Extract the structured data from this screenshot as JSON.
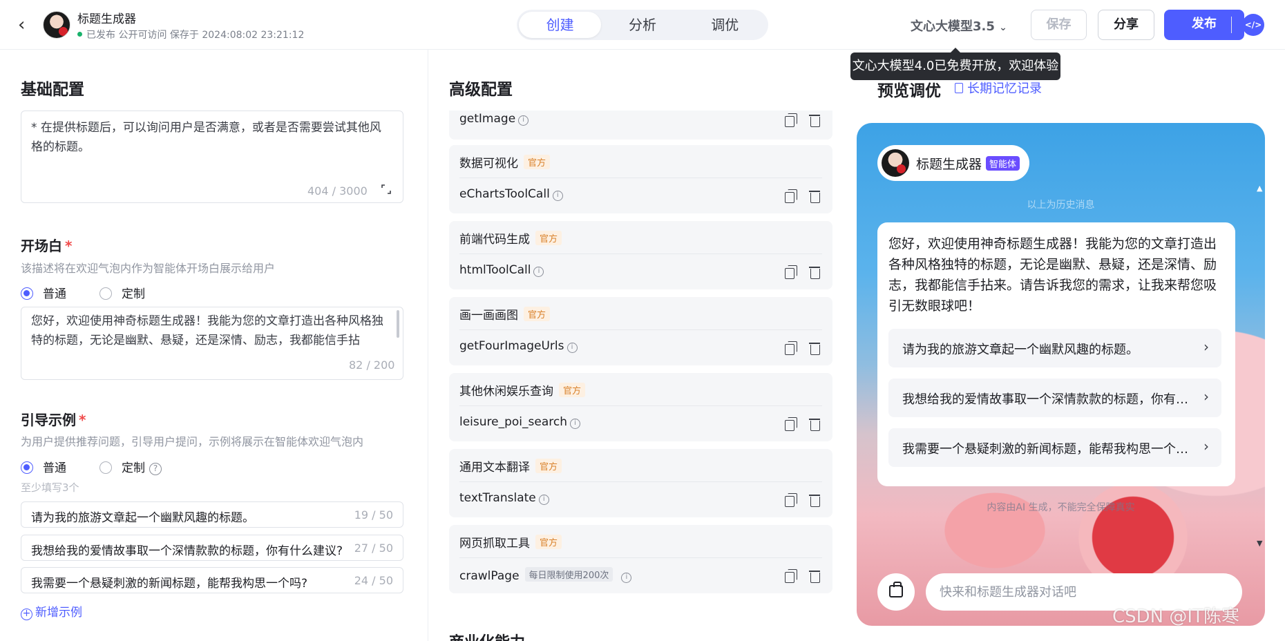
{
  "header": {
    "app_name": "标题生成器",
    "status": "已发布 公开可访问 保存于 2024:08:02 23:21:12",
    "tabs": [
      {
        "label": "创建",
        "active": true
      },
      {
        "label": "分析",
        "active": false
      },
      {
        "label": "调优",
        "active": false
      }
    ],
    "model": "文心大模型3.5",
    "save": "保存",
    "share": "分享",
    "publish": "发布"
  },
  "tooltip": "文心大模型4.0已免费开放，欢迎体验",
  "basic": {
    "title": "基础配置",
    "prompt_excerpt": "* 在提供标题后，可以询问用户是否满意，或者是否需要尝试其他风格的标题。",
    "prompt_count": "404 / 3000",
    "opening": {
      "title": "开场白",
      "required": "*",
      "desc": "该描述将在欢迎气泡内作为智能体开场白展示给用户",
      "radio_normal": "普通",
      "radio_custom": "定制",
      "text": "您好，欢迎使用神奇标题生成器！我能为您的文章打造出各种风格独特的标题，无论是幽默、悬疑，还是深情、励志，我都能信手拈",
      "count": "82 / 200"
    },
    "guide": {
      "title": "引导示例",
      "required": "*",
      "desc": "为用户提供推荐问题，引导用户提问，示例将展示在智能体欢迎气泡内",
      "radio_normal": "普通",
      "radio_custom": "定制",
      "help": "?",
      "min_hint": "至少填写3个",
      "examples": [
        {
          "text": "请为我的旅游文章起一个幽默风趣的标题。",
          "count": "19 / 50"
        },
        {
          "text": "我想给我的爱情故事取一个深情款款的标题，你有什么建议?",
          "count": "27 / 50"
        },
        {
          "text": "我需要一个悬疑刺激的新闻标题，能帮我构思一个吗?",
          "count": "24 / 50"
        }
      ],
      "add": "新增示例"
    }
  },
  "advanced": {
    "title": "高级配置",
    "first_tool": "getImage",
    "official_label": "官方",
    "cards": [
      {
        "category": "数据可视化",
        "tool": "eChartsToolCall"
      },
      {
        "category": "前端代码生成",
        "tool": "htmlToolCall"
      },
      {
        "category": "画一画画图",
        "tool": "getFourImageUrls"
      },
      {
        "category": "其他休闲娱乐查询",
        "tool": "leisure_poi_search"
      },
      {
        "category": "通用文本翻译",
        "tool": "textTranslate"
      },
      {
        "category": "网页抓取工具",
        "tool": "crawlPage",
        "limit": "每日限制使用200次"
      }
    ],
    "next_section": "商业化能力"
  },
  "preview": {
    "title": "预览调优",
    "memory_link": "长期记忆记录",
    "agent_name": "标题生成器",
    "agent_badge": "智能体",
    "history_note": "以上为历史消息",
    "welcome": "您好，欢迎使用神奇标题生成器！我能为您的文章打造出各种风格独特的标题，无论是幽默、悬疑，还是深情、励志，我都能信手拈来。请告诉我您的需求，让我来帮您吸引无数眼球吧！",
    "suggestions": [
      "请为我的旅游文章起一个幽默风趣的标题。",
      "我想给我的爱情故事取一个深情款款的标题，你有什么建议?",
      "我需要一个悬疑刺激的新闻标题，能帮我构思一个吗?"
    ],
    "ai_note": "内容由AI 生成，不能完全保障真实",
    "input_placeholder": "快来和标题生成器对话吧"
  },
  "watermark": "CSDN @IT陈寒",
  "colors": {
    "accent": "#4e5dff",
    "official_badge": "#d9812a",
    "published_dot": "#19b26b"
  }
}
